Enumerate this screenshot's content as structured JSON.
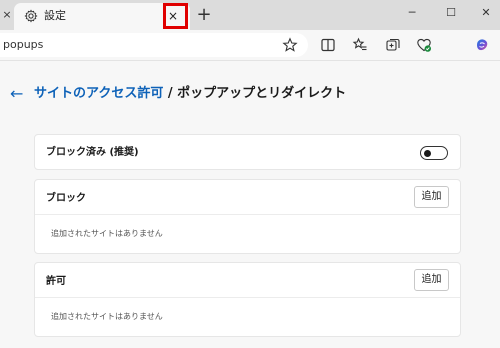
{
  "browser": {
    "prev_tab_close": "×",
    "tab": {
      "title": "設定",
      "close": "×"
    },
    "new_tab": "+",
    "window_controls": {
      "minimize": "─",
      "maximize": "☐",
      "close": "✕"
    },
    "address_text": "popups",
    "toolbar_icons": [
      "star-icon",
      "split-screen-icon",
      "favorites-icon",
      "collections-icon",
      "browser-essentials-icon",
      "copilot-icon"
    ]
  },
  "page": {
    "breadcrumb_parent": "サイトのアクセス許可",
    "separator": " / ",
    "title": "ポップアップとリダイレクト"
  },
  "blocked_setting": {
    "label": "ブロック済み (推奨)",
    "toggle_on": false
  },
  "block_section": {
    "label": "ブロック",
    "add_button": "追加",
    "empty_text": "追加されたサイトはありません"
  },
  "allow_section": {
    "label": "許可",
    "add_button": "追加",
    "empty_text": "追加されたサイトはありません"
  },
  "colors": {
    "accent": "#0e62b8",
    "highlight": "#e00000"
  }
}
